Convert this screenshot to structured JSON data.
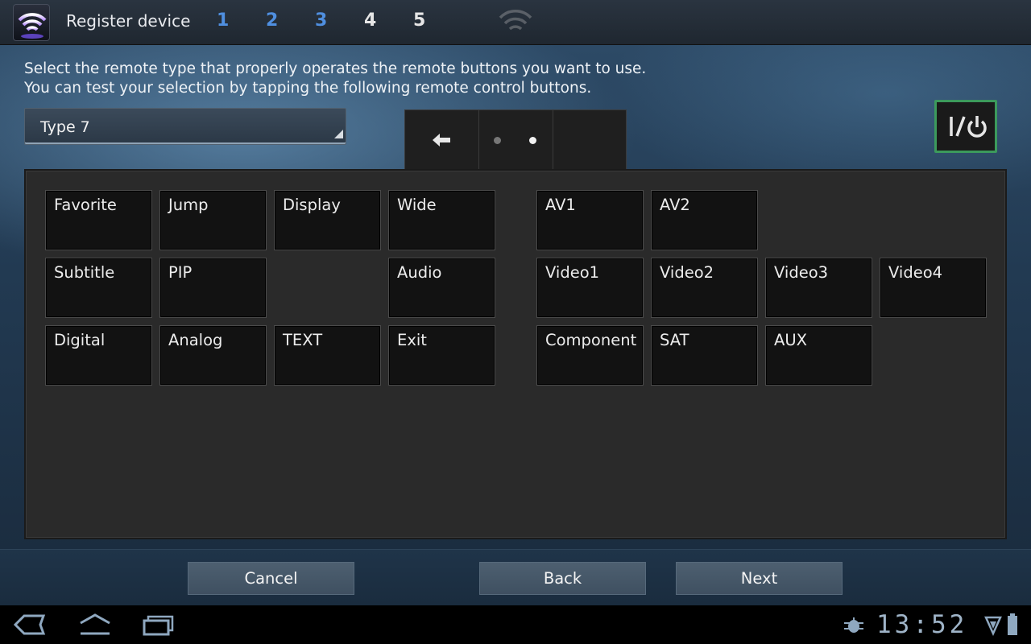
{
  "topbar": {
    "title": "Register device",
    "steps": [
      "1",
      "2",
      "3",
      "4",
      "5"
    ]
  },
  "instructions": {
    "line1": "Select the remote type that properly operates the remote buttons you want to use.",
    "line2": "You can test your selection by tapping the following remote control buttons."
  },
  "type_select": {
    "value": "Type 7"
  },
  "pager": {
    "pages": 2,
    "current_page": 2
  },
  "remote_buttons": {
    "favorite": "Favorite",
    "jump": "Jump",
    "display": "Display",
    "wide": "Wide",
    "subtitle": "Subtitle",
    "pip": "PIP",
    "audio": "Audio",
    "digital": "Digital",
    "analog": "Analog",
    "text": "TEXT",
    "exit": "Exit",
    "av1": "AV1",
    "av2": "AV2",
    "video1": "Video1",
    "video2": "Video2",
    "video3": "Video3",
    "video4": "Video4",
    "component": "Component",
    "sat": "SAT",
    "aux": "AUX"
  },
  "footer": {
    "cancel": "Cancel",
    "back": "Back",
    "next": "Next"
  },
  "system_bar": {
    "time": "13:52"
  },
  "colors": {
    "step_done": "#4f8fe0",
    "step_todo": "#e6e6e6",
    "power_border": "#3c9a5c",
    "clock": "#9fb4c8"
  }
}
